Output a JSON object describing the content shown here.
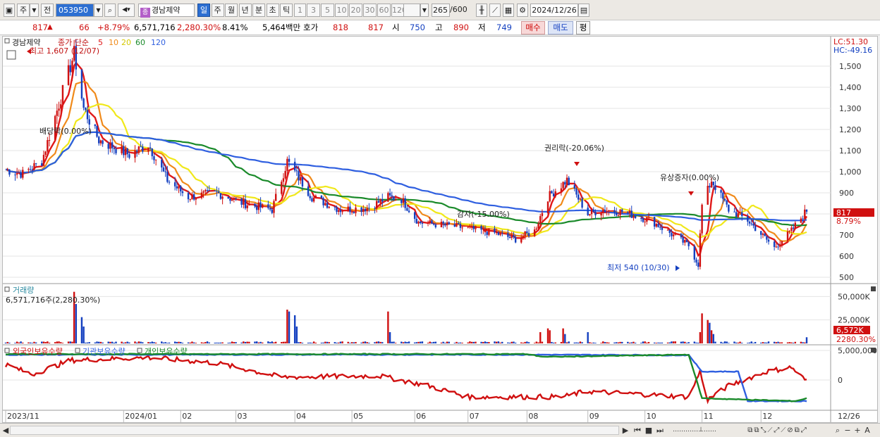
{
  "toolbar": {
    "market": "주",
    "period_prefix": "전",
    "stock_code": "053950",
    "stock_name": "경남제약",
    "stock_tag": "종",
    "period_buttons": [
      "일",
      "주",
      "월",
      "년",
      "분",
      "초",
      "틱"
    ],
    "active_period": "일",
    "minute_buttons": [
      "1",
      "3",
      "5",
      "10",
      "20",
      "30",
      "60",
      "120"
    ],
    "count_display": "265",
    "count_total": "/600",
    "date": "2024/12/26"
  },
  "quote": {
    "price": "817",
    "change_arrow": "▲",
    "change": "66",
    "change_pct": "+8.79%",
    "volume": "6,571,716",
    "volume_ratio": "2,280.30%",
    "turnover": "8.41%",
    "amount": "5,464백만",
    "hoga_label": "호가",
    "ask": "818",
    "bid": "817",
    "open_label": "시",
    "open": "750",
    "high_label": "고",
    "high": "890",
    "low_label": "저",
    "low": "749",
    "buy_label": "매수",
    "sell_label": "매도",
    "avg_label": "평"
  },
  "price_panel": {
    "legend_name": "경남제약",
    "legend_ma": "종가 단순",
    "ma_periods": [
      "5",
      "10",
      "20",
      "60",
      "120"
    ],
    "high_annotation": "최고 1,607 (12/07)",
    "low_annotation": "최저 540 (10/30)",
    "lc_label": "LC:51.30",
    "hc_label": "HC:-49.16",
    "current_price_tag": "817",
    "current_pct_tag": "8.79%",
    "events": [
      "배당락(0.00%)",
      "감자(-15.00%)",
      "권리락(-20.06%)",
      "유상증자(0.00%)"
    ]
  },
  "volume_panel": {
    "title": "거래량",
    "value_text": "6,571,716주(2,280.30%)",
    "current_tag": "6,572K",
    "pct_tag": "2280.30%"
  },
  "ownership_panel": {
    "items": [
      "외국인보유수량",
      "기관보유수량",
      "개인보유수량"
    ]
  },
  "x_axis": [
    "2023/11",
    "2024/01",
    "02",
    "03",
    "04",
    "05",
    "06",
    "07",
    "08",
    "09",
    "10",
    "11",
    "12",
    "12/26"
  ],
  "colors": {
    "up": "#d01010",
    "down": "#1440c0",
    "ma5": "#e01818",
    "ma10": "#f08a1a",
    "ma20": "#f0e81a",
    "ma60": "#1a8a2a",
    "ma120": "#2f5fe0",
    "own_foreign": "#d01010",
    "own_institution": "#2f5fe0",
    "own_individual": "#1a8a2a"
  },
  "chart_data": [
    {
      "type": "line",
      "title": "경남제약 일봉",
      "ylim": [
        480,
        1620
      ],
      "y_ticks": [
        "500",
        "600",
        "700",
        "800",
        "900",
        "1,000",
        "1,100",
        "1,200",
        "1,300",
        "1,400",
        "1,500"
      ],
      "anchors": [
        [
          "2023-11-01",
          1010
        ],
        [
          "2023-11-10",
          990
        ],
        [
          "2023-11-20",
          1050
        ],
        [
          "2023-12-07",
          1560
        ],
        [
          "2023-12-12",
          1300
        ],
        [
          "2023-12-20",
          1150
        ],
        [
          "2024-01-05",
          1080
        ],
        [
          "2024-01-15",
          1130
        ],
        [
          "2024-01-25",
          960
        ],
        [
          "2024-02-05",
          880
        ],
        [
          "2024-02-20",
          900
        ],
        [
          "2024-03-05",
          850
        ],
        [
          "2024-03-20",
          820
        ],
        [
          "2024-03-28",
          1050
        ],
        [
          "2024-04-10",
          880
        ],
        [
          "2024-04-25",
          820
        ],
        [
          "2024-05-10",
          830
        ],
        [
          "2024-05-20",
          880
        ],
        [
          "2024-05-27",
          870
        ],
        [
          "2024-06-05",
          760
        ],
        [
          "2024-06-25",
          740
        ],
        [
          "2024-07-15",
          710
        ],
        [
          "2024-07-26",
          680
        ],
        [
          "2024-08-05",
          720
        ],
        [
          "2024-08-12",
          880
        ],
        [
          "2024-08-22",
          960
        ],
        [
          "2024-09-02",
          800
        ],
        [
          "2024-09-10",
          820
        ],
        [
          "2024-09-20",
          810
        ],
        [
          "2024-10-05",
          770
        ],
        [
          "2024-10-25",
          650
        ],
        [
          "2024-10-30",
          560
        ],
        [
          "2024-11-01",
          840
        ],
        [
          "2024-11-06",
          960
        ],
        [
          "2024-11-15",
          820
        ],
        [
          "2024-11-25",
          770
        ],
        [
          "2024-12-09",
          640
        ],
        [
          "2024-12-18",
          720
        ],
        [
          "2024-12-26",
          817
        ]
      ],
      "ma_series": [
        "5",
        "10",
        "20",
        "60",
        "120"
      ]
    },
    {
      "type": "bar",
      "title": "거래량",
      "ylim": [
        0,
        60000
      ],
      "y_ticks": [
        "25,000K",
        "50,000K"
      ],
      "spikes": [
        [
          "2023-12-07",
          55000
        ],
        [
          "2023-12-08",
          42000
        ],
        [
          "2023-12-11",
          28000
        ],
        [
          "2023-12-12",
          18000
        ],
        [
          "2024-03-28",
          36000
        ],
        [
          "2024-03-29",
          34000
        ],
        [
          "2024-04-01",
          30000
        ],
        [
          "2024-04-02",
          18000
        ],
        [
          "2024-05-20",
          34000
        ],
        [
          "2024-05-21",
          12000
        ],
        [
          "2024-08-08",
          12000
        ],
        [
          "2024-08-12",
          16000
        ],
        [
          "2024-08-13",
          14000
        ],
        [
          "2024-08-20",
          16000
        ],
        [
          "2024-08-21",
          10000
        ],
        [
          "2024-09-02",
          12000
        ],
        [
          "2024-10-31",
          12000
        ],
        [
          "2024-11-01",
          32000
        ],
        [
          "2024-11-04",
          25000
        ],
        [
          "2024-11-05",
          22000
        ],
        [
          "2024-11-06",
          14000
        ],
        [
          "2024-11-07",
          10000
        ],
        [
          "2024-12-26",
          6572
        ]
      ]
    },
    {
      "type": "line",
      "title": "보유수량",
      "y_ticks": [
        "0",
        "5,000,000"
      ],
      "series": [
        {
          "name": "외국인보유수량",
          "anchors": [
            [
              "2023-11-01",
              0.55
            ],
            [
              "2023-11-15",
              0.2
            ],
            [
              "2023-12-05",
              0.7
            ],
            [
              "2024-01-15",
              0.8
            ],
            [
              "2024-02-20",
              0.6
            ],
            [
              "2024-03-25",
              0.1
            ],
            [
              "2024-05-15",
              0.15
            ],
            [
              "2024-06-10",
              -0.2
            ],
            [
              "2024-07-01",
              -0.6
            ],
            [
              "2024-08-20",
              -0.6
            ],
            [
              "2024-09-01",
              -0.4
            ],
            [
              "2024-10-25",
              -0.6
            ],
            [
              "2024-10-31",
              0.3
            ],
            [
              "2024-11-04",
              -0.7
            ],
            [
              "2024-11-15",
              -0.2
            ],
            [
              "2024-12-05",
              0.3
            ],
            [
              "2024-12-18",
              0.45
            ],
            [
              "2024-12-26",
              -0.05
            ]
          ]
        },
        {
          "name": "기관보유수량",
          "anchors": [
            [
              "2023-11-01",
              0.9
            ],
            [
              "2024-08-01",
              0.9
            ],
            [
              "2024-10-25",
              0.88
            ],
            [
              "2024-11-01",
              0.3
            ],
            [
              "2024-11-20",
              0.3
            ],
            [
              "2024-11-25",
              -0.75
            ],
            [
              "2024-12-26",
              -0.75
            ]
          ]
        },
        {
          "name": "개인보유수량",
          "anchors": [
            [
              "2023-11-01",
              0.92
            ],
            [
              "2024-08-01",
              0.92
            ],
            [
              "2024-08-10",
              0.82
            ],
            [
              "2024-10-25",
              0.9
            ],
            [
              "2024-11-01",
              -0.65
            ],
            [
              "2024-12-20",
              -0.75
            ],
            [
              "2024-12-26",
              -0.65
            ]
          ]
        }
      ]
    }
  ]
}
